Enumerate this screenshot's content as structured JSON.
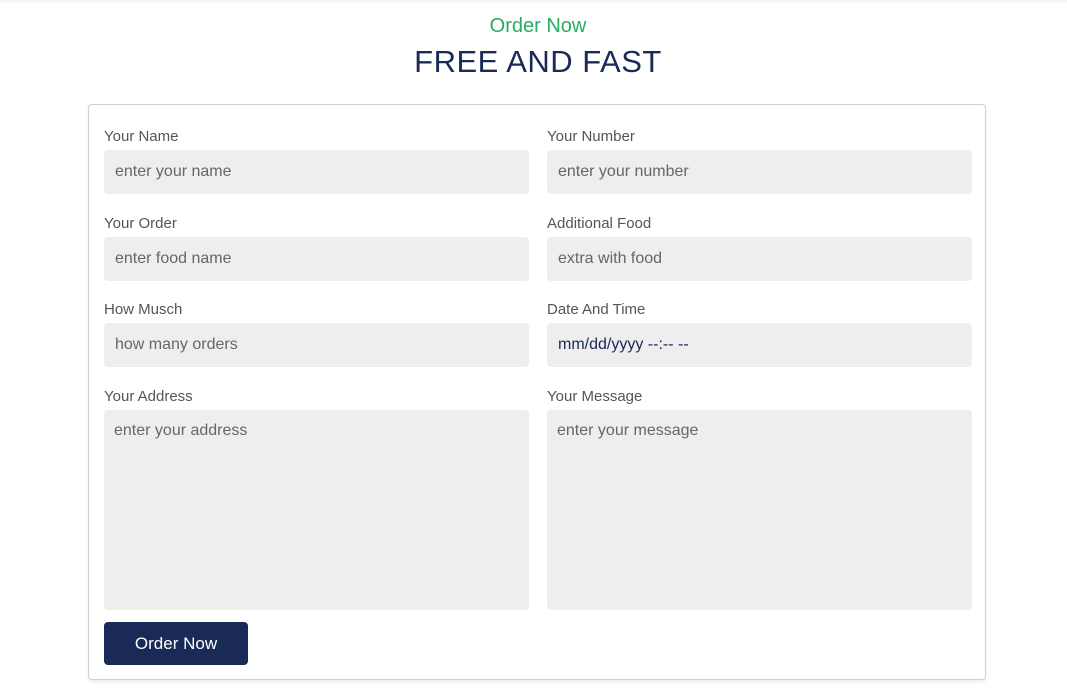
{
  "header": {
    "subtitle": "Order Now",
    "title": "FREE AND FAST"
  },
  "form": {
    "fields": [
      {
        "label": "Your Name",
        "placeholder": "enter your name"
      },
      {
        "label": "Your Number",
        "placeholder": "enter your number"
      },
      {
        "label": "Your Order",
        "placeholder": "enter food name"
      },
      {
        "label": "Additional Food",
        "placeholder": "extra with food"
      },
      {
        "label": "How Musch",
        "placeholder": "how many orders"
      },
      {
        "label": "Date And Time",
        "value": "mm/dd/yyyy --:-- --"
      },
      {
        "label": "Your Address",
        "placeholder": "enter your address"
      },
      {
        "label": "Your Message",
        "placeholder": "enter your message"
      }
    ],
    "submit_label": "Order Now"
  },
  "colors": {
    "accent": "#27ae60",
    "primary": "#192a56",
    "input_bg": "#eeeeee"
  }
}
